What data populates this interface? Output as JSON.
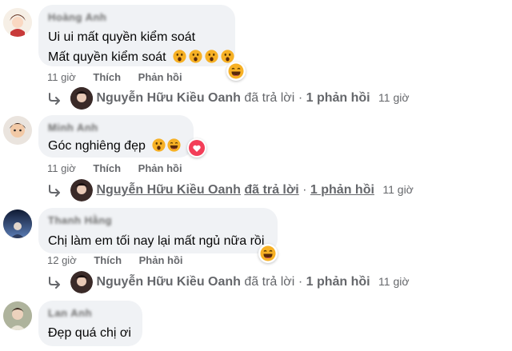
{
  "comments": [
    {
      "author": "Hoàng Anh",
      "lines": [
        "Ui ui mất quyền kiểm soát",
        "Mất quyền kiểm soát"
      ],
      "emoji_count": 4,
      "emoji": "astonished-face",
      "reaction": "laughing-face",
      "time": "11 giờ",
      "like": "Thích",
      "reply": "Phản hồi",
      "reply_summary": {
        "name": "Nguyễn Hữu Kiều Oanh",
        "verb": "đã trả lời",
        "sep": "·",
        "count": "1 phản hồi",
        "time": "11 giờ"
      }
    },
    {
      "author": "Minh Anh",
      "lines": [
        "Góc nghiêng đẹp"
      ],
      "emoji": "laughing-emojis",
      "reaction": "love-heart",
      "time": "11 giờ",
      "like": "Thích",
      "reply": "Phản hồi",
      "reply_summary": {
        "name": "Nguyễn Hữu Kiều Oanh",
        "verb": "đã trả lời",
        "sep": "·",
        "count": "1 phản hồi",
        "time": "11 giờ"
      }
    },
    {
      "author": "Thanh Hằng",
      "lines": [
        "Chị làm em tối nay lại mất ngủ nữa rồi"
      ],
      "reaction": "laughing-face",
      "time": "12 giờ",
      "like": "Thích",
      "reply": "Phản hồi",
      "reply_summary": {
        "name": "Nguyễn Hữu Kiều Oanh",
        "verb": "đã trả lời",
        "sep": "·",
        "count": "1 phản hồi",
        "time": "11 giờ"
      }
    },
    {
      "author": "Lan Anh",
      "lines": [
        "Đẹp quá chị ơi"
      ]
    }
  ],
  "colors": {
    "bubble": "#f0f2f5",
    "meta": "#65676b",
    "text": "#050505",
    "love": "#f33e58",
    "emoji": "#f7b125"
  }
}
